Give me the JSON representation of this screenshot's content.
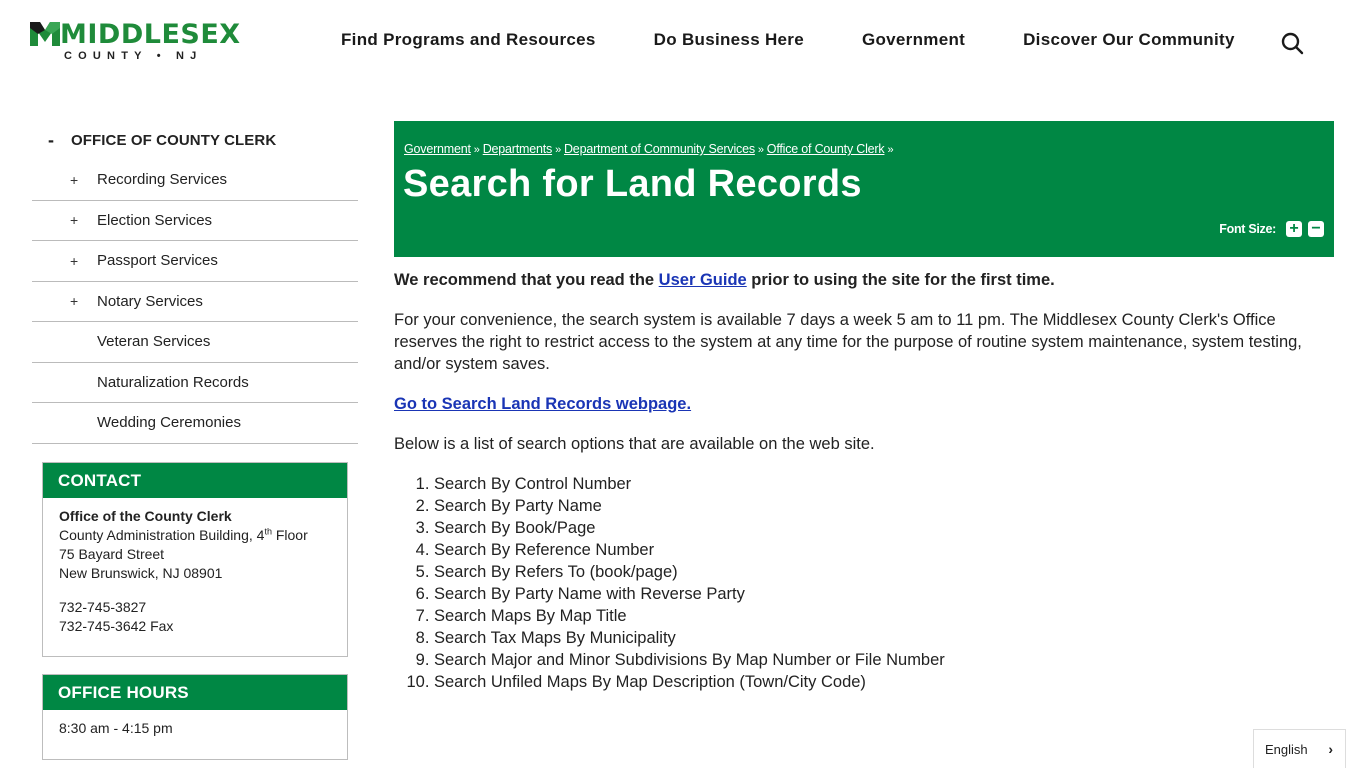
{
  "brand": {
    "name": "MIDDLESEX",
    "tagline": "COUNTY • NJ",
    "primary_color": "#008744",
    "link_color": "#1a35b5"
  },
  "nav": {
    "items": [
      {
        "label": "Find Programs and Resources"
      },
      {
        "label": "Do Business Here"
      },
      {
        "label": "Government"
      },
      {
        "label": "Discover Our Community"
      }
    ],
    "search_icon": "search-icon"
  },
  "sidebar": {
    "header": {
      "toggle": "-",
      "label": "OFFICE OF COUNTY CLERK"
    },
    "items": [
      {
        "toggle": "+",
        "label": "Recording Services"
      },
      {
        "toggle": "+",
        "label": "Election Services"
      },
      {
        "toggle": "+",
        "label": "Passport Services"
      },
      {
        "toggle": "+",
        "label": "Notary Services"
      },
      {
        "toggle": "",
        "label": "Veteran Services"
      },
      {
        "toggle": "",
        "label": "Naturalization Records"
      },
      {
        "toggle": "",
        "label": "Wedding Ceremonies"
      }
    ]
  },
  "contact": {
    "title": "CONTACT",
    "office": "Office of the County Clerk",
    "building_pre": "County Administration Building, 4",
    "building_sup": "th",
    "building_post": " Floor",
    "street": "75 Bayard Street",
    "city": "New Brunswick, NJ 08901",
    "phone": "732-745-3827",
    "fax": "732-745-3642 Fax"
  },
  "hours": {
    "title": "OFFICE HOURS",
    "value": "8:30 am - 4:15 pm"
  },
  "banner": {
    "breadcrumbs": [
      {
        "label": "Government"
      },
      {
        "label": "Departments"
      },
      {
        "label": "Department of Community Services"
      },
      {
        "label": "Office of County Clerk"
      }
    ],
    "separator": "»",
    "title": "Search for Land Records",
    "font_size_label": "Font Size:",
    "font_increase": "+",
    "font_decrease": "−"
  },
  "content": {
    "intro_pre": "We recommend that you read the ",
    "intro_link": "User Guide",
    "intro_post": " prior to using the site for the first time.",
    "availability": "For your convenience, the search system is available 7 days a week 5 am to 11 pm. The Middlesex County Clerk's Office reserves the right to restrict access to the system at any time for the purpose of routine system maintenance, system testing, and/or system saves.",
    "goto_link": "Go to Search Land Records webpage.",
    "list_intro": "Below is a list of search options that are available on the web site.",
    "options": [
      "Search By Control Number",
      "Search By Party Name",
      "Search By Book/Page",
      "Search By Reference Number",
      "Search By Refers To (book/page)",
      "Search By Party Name with Reverse Party",
      "Search Maps By Map Title",
      "Search Tax Maps By Municipality",
      "Search Major and Minor Subdivisions By Map Number or File Number",
      "Search Unfiled Maps By Map Description (Town/City Code)"
    ]
  },
  "language": {
    "label": "English",
    "chevron": "›"
  }
}
